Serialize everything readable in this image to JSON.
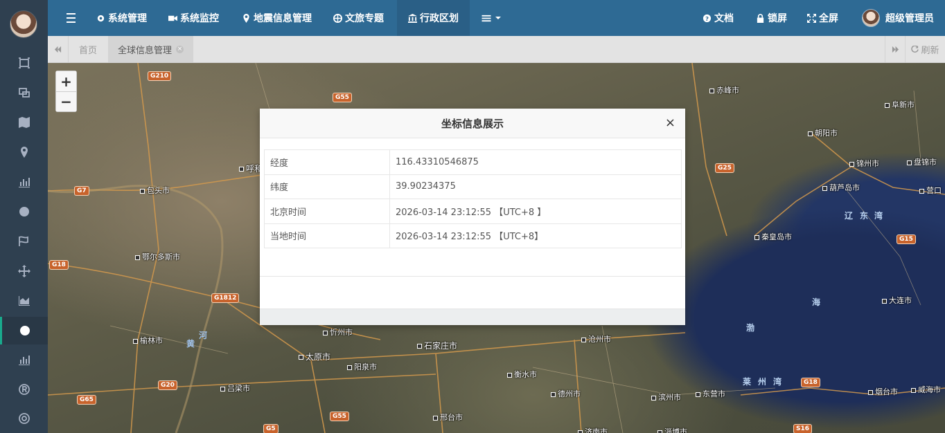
{
  "topnav": {
    "items": [
      {
        "label": "系统管理",
        "icon": "gear-icon"
      },
      {
        "label": "系统监控",
        "icon": "video-icon"
      },
      {
        "label": "地震信息管理",
        "icon": "map-marker-icon"
      },
      {
        "label": "文旅专题",
        "icon": "globe-icon"
      },
      {
        "label": "行政区划",
        "icon": "bank-icon"
      }
    ],
    "right": {
      "docs": "文档",
      "lock": "锁屏",
      "fullscreen": "全屏",
      "user": "超级管理员"
    }
  },
  "tabs": {
    "home": "首页",
    "current": "全球信息管理",
    "refresh": "刷新"
  },
  "map": {
    "zoom_in": "+",
    "zoom_out": "−",
    "sea_labels": [
      "辽",
      "东",
      "湾",
      "渤",
      "海",
      "莱",
      "州",
      "湾"
    ],
    "cities": [
      "赤峰市",
      "阜新市",
      "朝阳市",
      "锦州市",
      "盘锦市",
      "葫芦岛市",
      "营口",
      "秦皇岛市",
      "大连市",
      "包头市",
      "呼和",
      "鄂尔多斯市",
      "榆林市",
      "忻州市",
      "太原市",
      "阳泉市",
      "石家庄市",
      "沧州市",
      "衡水市",
      "德州市",
      "滨州市",
      "东营市",
      "烟台市",
      "威海市",
      "邢台市",
      "吕梁市",
      "济南市",
      "淄博市"
    ],
    "highways": [
      "G210",
      "G55",
      "G7",
      "G18",
      "G1812",
      "G25",
      "G15",
      "G20",
      "G65",
      "G55",
      "G18",
      "G5",
      "S16"
    ],
    "river": [
      "黄",
      "河"
    ]
  },
  "modal": {
    "title": "坐标信息展示",
    "close": "×",
    "rows": [
      {
        "key": "经度",
        "value": "116.43310546875"
      },
      {
        "key": "纬度",
        "value": "39.90234375"
      },
      {
        "key": "北京时间",
        "value": "2026-03-14 23:12:55 【UTC+8 】"
      },
      {
        "key": "当地时间",
        "value": "2026-03-14 23:12:55 【UTC+8】"
      }
    ]
  }
}
